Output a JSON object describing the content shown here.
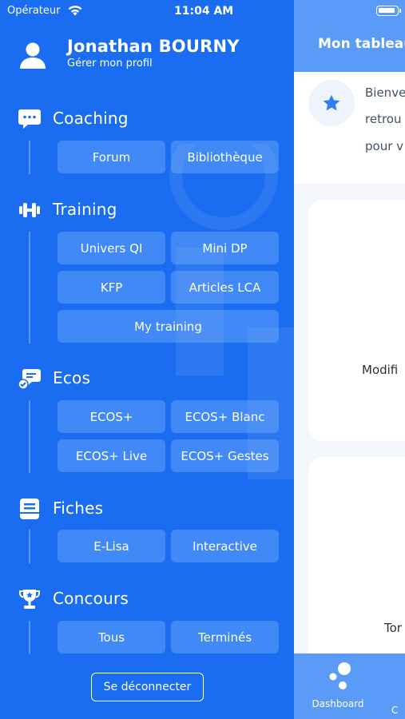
{
  "status_bar": {
    "carrier": "Opérateur",
    "time": "11:04 AM"
  },
  "profile": {
    "name": "Jonathan BOURNY",
    "link": "Gérer mon profil"
  },
  "sections": {
    "coaching": {
      "title": "Coaching",
      "items": [
        "Forum",
        "Bibliothèque"
      ]
    },
    "training": {
      "title": "Training",
      "items": [
        "Univers QI",
        "Mini DP",
        "KFP",
        "Articles LCA",
        "My training"
      ]
    },
    "ecos": {
      "title": "Ecos",
      "items": [
        "ECOS+",
        "ECOS+ Blanc",
        "ECOS+ Live",
        "ECOS+ Gestes"
      ]
    },
    "fiches": {
      "title": "Fiches",
      "items": [
        "E-Lisa",
        "Interactive"
      ]
    },
    "concours": {
      "title": "Concours",
      "items": [
        "Tous",
        "Terminés"
      ]
    }
  },
  "logout_label": "Se déconnecter",
  "main": {
    "title": "Mon tableau",
    "welcome_lines": [
      "Bienve",
      "retrou",
      "pour v"
    ],
    "card1_label": "Modifi",
    "card2_label": "Tor",
    "tab_dashboard": "Dashboard",
    "tab_second": "C"
  },
  "colors": {
    "drawer": "#1a6cf0",
    "header": "#5b9bf8",
    "chip": "#5f9ef7",
    "background": "#f3f6fb"
  }
}
